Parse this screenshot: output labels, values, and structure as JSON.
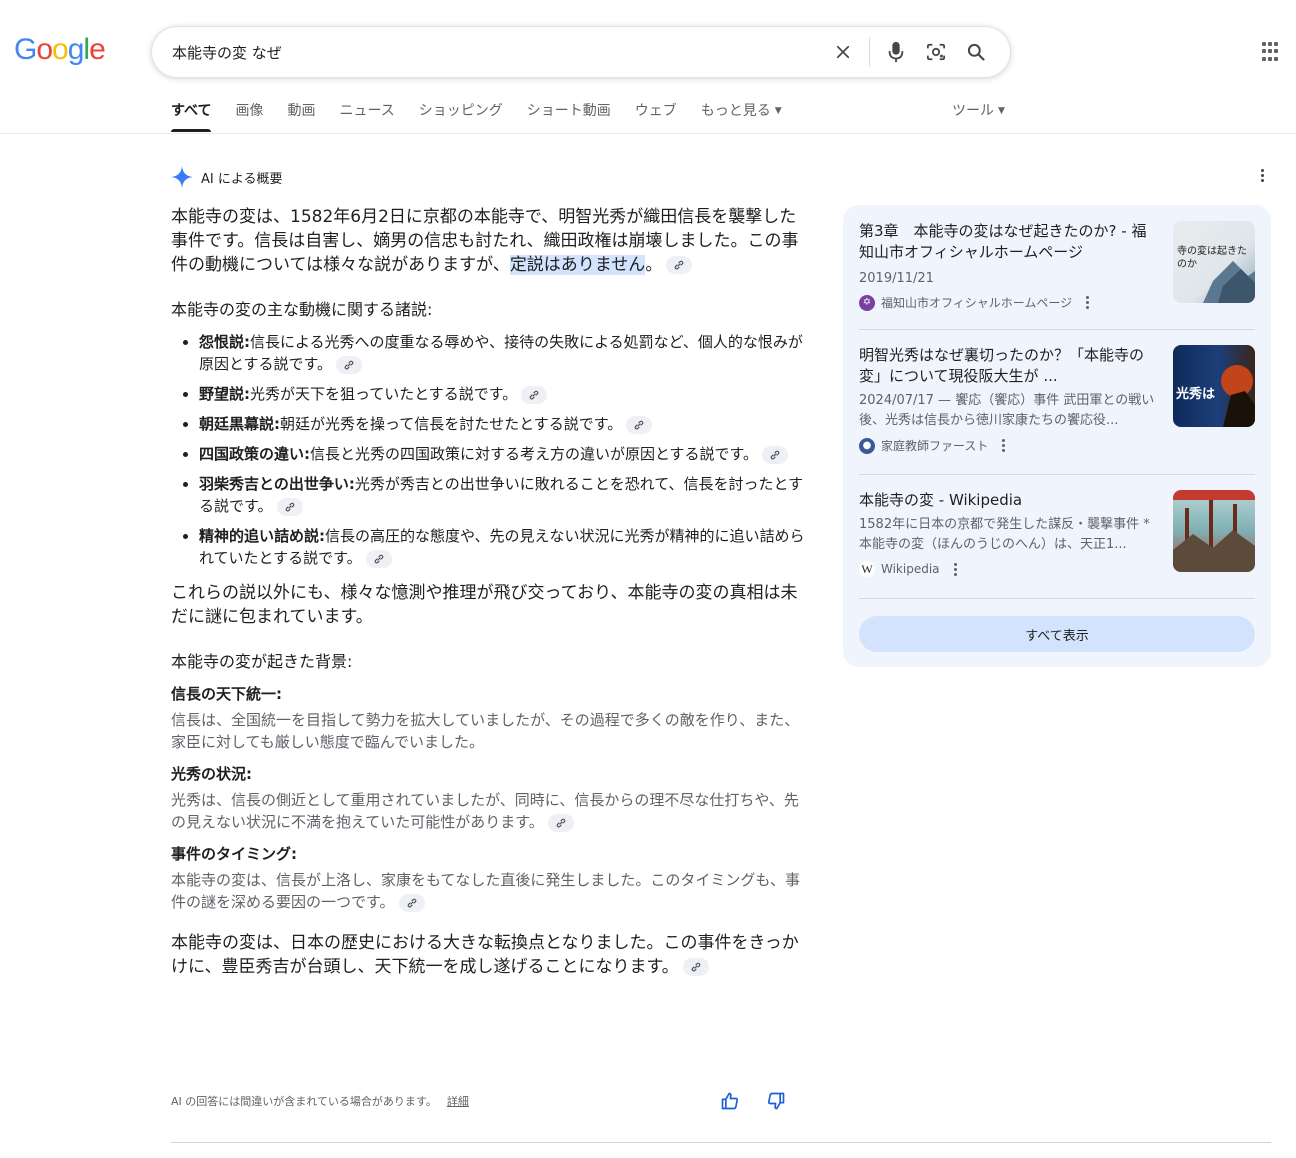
{
  "logo": {
    "letters": [
      "G",
      "o",
      "o",
      "g",
      "l",
      "e"
    ],
    "colors": [
      "#4285F4",
      "#EA4335",
      "#FBBC05",
      "#4285F4",
      "#34A853",
      "#EA4335"
    ]
  },
  "search": {
    "query": "本能寺の変 なぜ"
  },
  "tabs": [
    {
      "label": "すべて"
    },
    {
      "label": "画像"
    },
    {
      "label": "動画"
    },
    {
      "label": "ニュース"
    },
    {
      "label": "ショッピング"
    },
    {
      "label": "ショート動画"
    },
    {
      "label": "ウェブ"
    },
    {
      "label": "もっと見る"
    }
  ],
  "tools_label": "ツール",
  "ai": {
    "heading": "AI による概要",
    "lead_a": "本能寺の変は、1582年6月2日に京都の本能寺で、明智光秀が織田信長を襲撃した事件です。信長は自害し、嫡男の信忠も討たれ、織田政権は崩壊しました。この事件の動機については様々な説がありますが、",
    "lead_hl": "定説はありません",
    "lead_b": "。",
    "motives_heading": "本能寺の変の主な動機に関する諸説:",
    "motives": [
      {
        "term": "怨恨説:",
        "text": "信長による光秀への度重なる辱めや、接待の失敗による処罰など、個人的な恨みが原因とする説です。"
      },
      {
        "term": "野望説:",
        "text": "光秀が天下を狙っていたとする説です。"
      },
      {
        "term": "朝廷黒幕説:",
        "text": "朝廷が光秀を操って信長を討たせたとする説です。"
      },
      {
        "term": "四国政策の違い:",
        "text": "信長と光秀の四国政策に対する考え方の違いが原因とする説です。"
      },
      {
        "term": "羽柴秀吉との出世争い:",
        "text": "光秀が秀吉との出世争いに敗れることを恐れて、信長を討ったとする説です。"
      },
      {
        "term": "精神的追い詰め説:",
        "text": "信長の高圧的な態度や、先の見えない状況に光秀が精神的に追い詰められていたとする説です。"
      }
    ],
    "other_theories": "これらの説以外にも、様々な憶測や推理が飛び交っており、本能寺の変の真相は未だに謎に包まれています。",
    "background_heading": "本能寺の変が起きた背景:",
    "background": [
      {
        "title": "信長の天下統一:",
        "text": "信長は、全国統一を目指して勢力を拡大していましたが、その過程で多くの敵を作り、また、家臣に対しても厳しい態度で臨んでいました。"
      },
      {
        "title": "光秀の状況:",
        "text": "光秀は、信長の側近として重用されていましたが、同時に、信長からの理不尽な仕打ちや、先の見えない状況に不満を抱えていた可能性があります。"
      },
      {
        "title": "事件のタイミング:",
        "text": "本能寺の変は、信長が上洛し、家康をもてなした直後に発生しました。このタイミングも、事件の謎を深める要因の一つです。"
      }
    ],
    "conclusion": "本能寺の変は、日本の歴史における大きな転換点となりました。この事件をきっかけに、豊臣秀吉が台頭し、天下統一を成し遂げることになります。",
    "disclaimer": "AI の回答には間違いが含まれている場合があります。",
    "detail_link": "詳細"
  },
  "sources": [
    {
      "title": "第3章　本能寺の変はなぜ起きたのか? - 福知山市オフィシャルホームページ",
      "date": "2019/11/21",
      "snippet": "",
      "site": "福知山市オフィシャルホームページ",
      "site_icon_color": "#7b3fa0",
      "thumb_text": "寺の変は起きたのか"
    },
    {
      "title": "明智光秀はなぜ裏切ったのか？「本能寺の変」について現役阪大生が ...",
      "date": "",
      "snippet": "2024/07/17 — 饗応（饗応）事件 武田軍との戦い後、光秀は信長から徳川家康たちの饗応役...",
      "site": "家庭教師ファースト",
      "site_icon_color": "#3b5998",
      "thumb_text": "光秀は"
    },
    {
      "title": "本能寺の変 - Wikipedia",
      "date": "",
      "snippet": "1582年に日本の京都で発生した謀反・襲撃事件 * 本能寺の変（ほんのうじのへん）は、天正1...",
      "site": "Wikipedia",
      "site_icon_color": "#ffffff",
      "thumb_text": ""
    }
  ],
  "show_all_label": "すべて表示"
}
